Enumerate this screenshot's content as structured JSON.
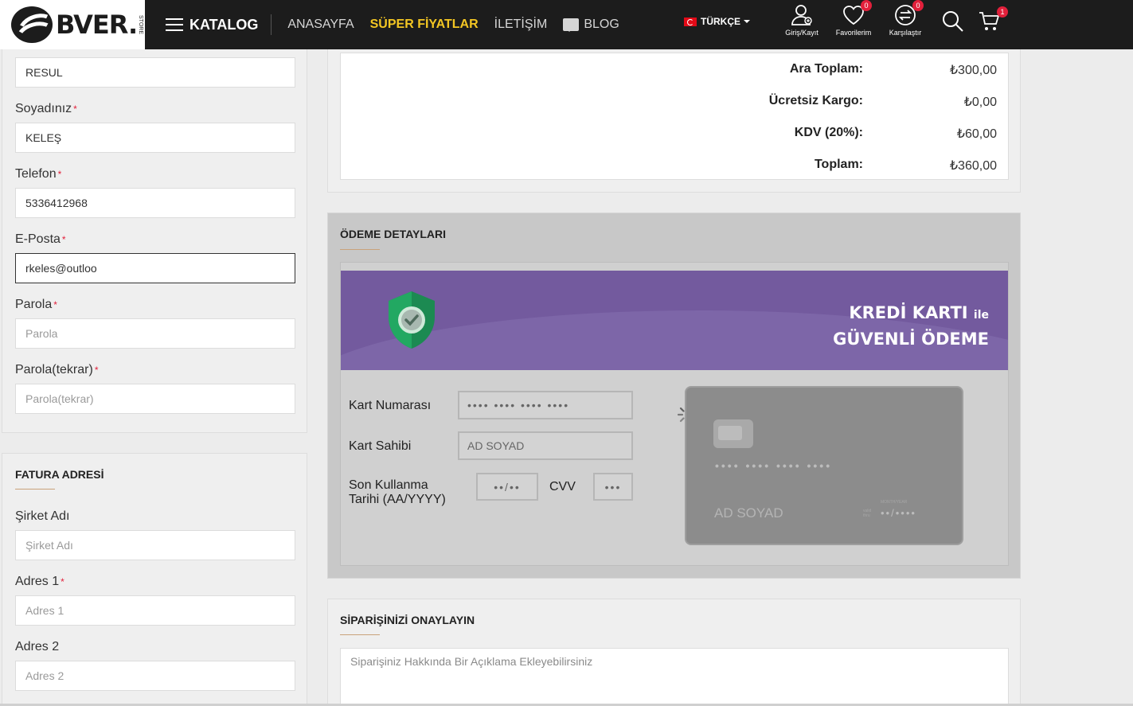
{
  "header": {
    "logo_text": "BVER.",
    "logo_sub": "STORE",
    "nav": {
      "katalog": "KATALOG",
      "anasayfa": "ANASAYFA",
      "super": "SÜPER FİYATLAR",
      "iletisim": "İLETİŞİM",
      "blog": "BLOG"
    },
    "language": "TÜRKÇE",
    "login_label": "Giriş/Kayıt",
    "favorites_label": "Favorilerim",
    "favorites_count": "0",
    "compare_label": "Karşılaştır",
    "compare_count": "0",
    "cart_count": "1"
  },
  "personal": {
    "name_value": "RESUL",
    "surname_label": "Soyadınız",
    "surname_value": "KELEŞ",
    "phone_label": "Telefon",
    "phone_value": "5336412968",
    "email_label": "E-Posta",
    "email_value": "rkeles@outloo",
    "password_label": "Parola",
    "password_placeholder": "Parola",
    "password2_label": "Parola(tekrar)",
    "password2_placeholder": "Parola(tekrar)",
    "required_mark": "*"
  },
  "billing": {
    "title": "FATURA ADRESİ",
    "company_label": "Şirket Adı",
    "company_placeholder": "Şirket Adı",
    "address1_label": "Adres 1",
    "address1_placeholder": "Adres 1",
    "address2_label": "Adres 2",
    "address2_placeholder": "Adres 2"
  },
  "totals": {
    "subtotal_label": "Ara Toplam:",
    "subtotal_value": "₺300,00",
    "shipping_label": "Ücretsiz Kargo:",
    "shipping_value": "₺0,00",
    "tax_label": "KDV (20%):",
    "tax_value": "₺60,00",
    "total_label": "Toplam:",
    "total_value": "₺360,00"
  },
  "payment": {
    "title": "ÖDEME DETAYLARI",
    "banner_line1": "KREDİ KARTI",
    "banner_line1_small": "ile",
    "banner_line2": "GÜVENLİ ÖDEME",
    "card_number_label": "Kart Numarası",
    "card_number_placeholder": "•••• •••• •••• ••••",
    "card_holder_label": "Kart Sahibi",
    "card_holder_placeholder": "AD SOYAD",
    "expiry_label": "Son Kullanma Tarihi (AA/YYYY)",
    "expiry_placeholder": "••/••",
    "cvv_label": "CVV",
    "cvv_placeholder": "•••",
    "card_preview_number": "•••• •••• •••• ••••",
    "card_preview_name": "AD  SOYAD",
    "card_preview_exp_label": "MONTH/YEAR",
    "card_preview_valid": "valid thru",
    "card_preview_exp": "••/••••"
  },
  "confirm": {
    "title": "SİPARİŞİNİZİ ONAYLAYIN",
    "comment_placeholder": "Siparişiniz Hakkında Bir Açıklama Ekleyebilirsiniz"
  },
  "colors": {
    "header_bg": "#1c1c1c",
    "accent_yellow": "#f3c623",
    "badge_red": "#e2203b",
    "banner_purple": "#735a9e",
    "shield_green": "#1fa463"
  }
}
